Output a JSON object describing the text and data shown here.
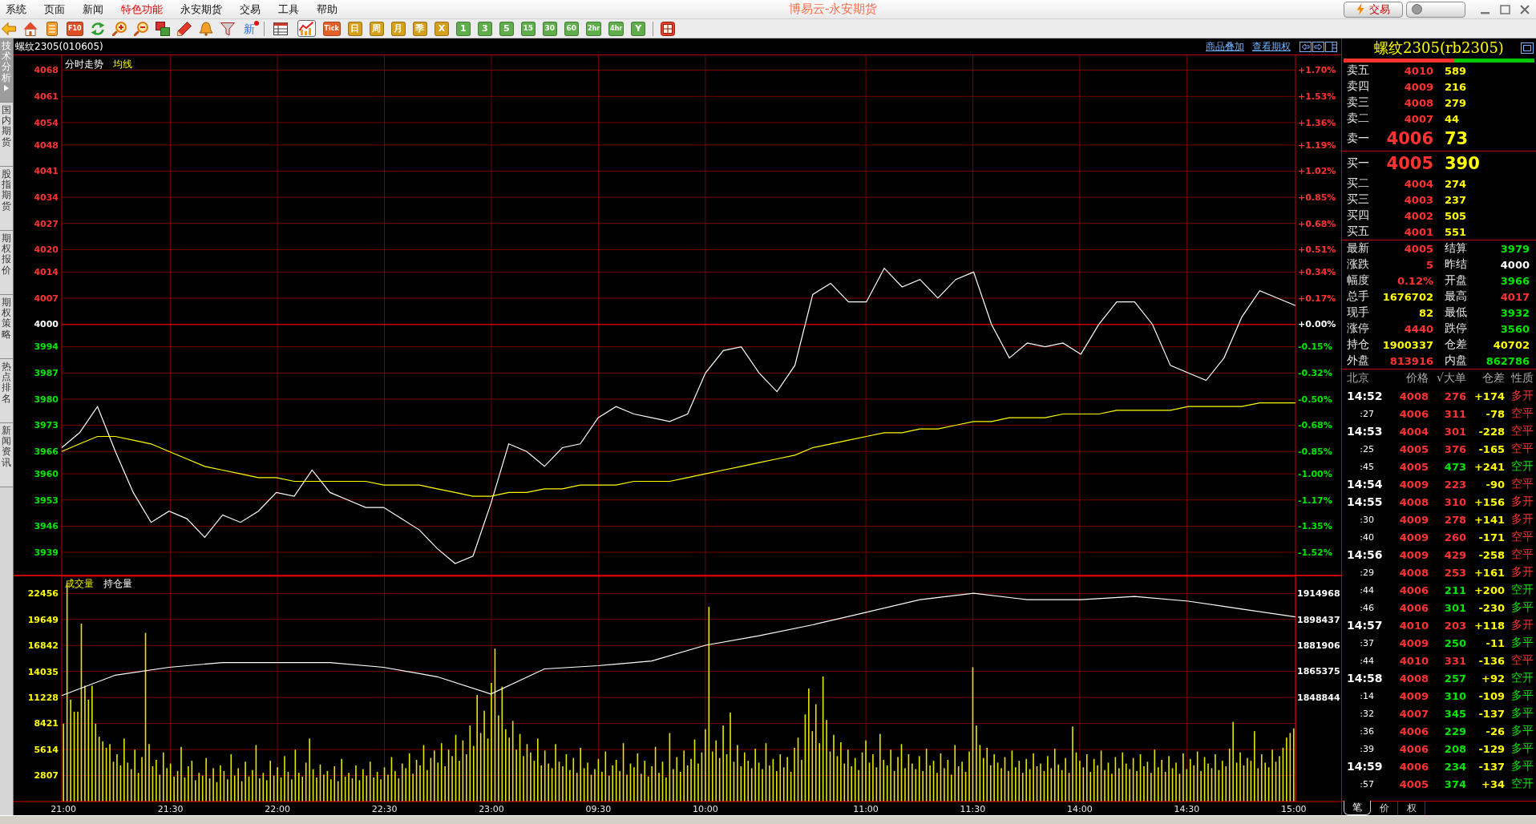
{
  "title_bar": {
    "menu": [
      {
        "label": "系统",
        "highlighted": false
      },
      {
        "label": "页面",
        "highlighted": false
      },
      {
        "label": "新闻",
        "highlighted": false
      },
      {
        "label": "特色功能",
        "highlighted": true
      },
      {
        "label": "永安期货",
        "highlighted": false
      },
      {
        "label": "交易",
        "highlighted": false
      },
      {
        "label": "工具",
        "highlighted": false
      },
      {
        "label": "帮助",
        "highlighted": false
      }
    ],
    "title": "博易云-永安期货",
    "trade_button": "交易"
  },
  "toolbar": {
    "actions": [
      {
        "kind": "arrow-left"
      },
      {
        "kind": "house"
      },
      {
        "kind": "notebook"
      },
      {
        "kind": "tile",
        "label": "F10"
      },
      {
        "kind": "refresh"
      },
      {
        "kind": "zoom-in"
      },
      {
        "kind": "zoom-out"
      },
      {
        "kind": "windows"
      },
      {
        "kind": "pencil"
      },
      {
        "kind": "bell"
      },
      {
        "kind": "funnel"
      },
      {
        "kind": "dot-text",
        "label": "新"
      }
    ],
    "views": [
      {
        "kind": "table",
        "selected": false
      },
      {
        "kind": "line-chart",
        "selected": true
      }
    ],
    "periods": [
      {
        "label": "Tick",
        "color": "#e4602a"
      },
      {
        "label": "日",
        "color": "#d6a01c"
      },
      {
        "label": "周",
        "color": "#d6a01c"
      },
      {
        "label": "月",
        "color": "#d6a01c"
      },
      {
        "label": "季",
        "color": "#d6a01c"
      },
      {
        "label": "X",
        "color": "#d6a01c"
      },
      {
        "label": "1",
        "color": "#5fae4b"
      },
      {
        "label": "3",
        "color": "#5fae4b"
      },
      {
        "label": "5",
        "color": "#5fae4b"
      },
      {
        "label": "15",
        "color": "#5fae4b"
      },
      {
        "label": "30",
        "color": "#5fae4b"
      },
      {
        "label": "60",
        "color": "#5fae4b"
      },
      {
        "label": "2hr",
        "color": "#5fae4b"
      },
      {
        "label": "4hr",
        "color": "#5fae4b"
      },
      {
        "label": "Y",
        "color": "#5fae4b"
      }
    ]
  },
  "sidebar": {
    "tabs": [
      {
        "label": "技术分析",
        "selected": true
      },
      {
        "label": "国内期货",
        "selected": false
      },
      {
        "label": "股指期货",
        "selected": false
      },
      {
        "label": "期权报价",
        "selected": false
      },
      {
        "label": "期权策略",
        "selected": false
      },
      {
        "label": "热点排名",
        "selected": false
      },
      {
        "label": "新闻资讯",
        "selected": false
      }
    ]
  },
  "chart_header": {
    "title": "螺纹2305(010605)",
    "links": [
      "商品叠加",
      "查看期权"
    ]
  },
  "price_chart": {
    "chart_data": {
      "type": "line",
      "categories": [
        null,
        null,
        null,
        null,
        null,
        null,
        null,
        null,
        null,
        null,
        null,
        null,
        null,
        null,
        null,
        null,
        null,
        null,
        null,
        null,
        null,
        null,
        null,
        null,
        null,
        null,
        null,
        null,
        null,
        null,
        null,
        null,
        null,
        null,
        null,
        null,
        null,
        null,
        null,
        null,
        null,
        null,
        null,
        null,
        null,
        null,
        null,
        null,
        null,
        null,
        null,
        null,
        null,
        null,
        null,
        null,
        null,
        null,
        null,
        null,
        null,
        null,
        null,
        null,
        null,
        null,
        null,
        null,
        null,
        null
      ],
      "ylim": [
        3933,
        4072
      ],
      "yticks": [
        4068,
        4061,
        4054,
        4048,
        4041,
        4034,
        4027,
        4020,
        4014,
        4007,
        4000,
        3994,
        3987,
        3980,
        3973,
        3966,
        3960,
        3953,
        3946,
        3939
      ],
      "grid": true,
      "ref_lines": [
        {
          "axis": "y",
          "value": 4000
        }
      ],
      "series": [
        {
          "name": "分时走势",
          "color": "#ffffff",
          "values": [
            3967,
            3971,
            3978,
            3966,
            3955,
            3947,
            3950,
            3948,
            3943,
            3949,
            3947,
            3950,
            3955,
            3954,
            3961,
            3955,
            3953,
            3951,
            3951,
            3948,
            3945,
            3940,
            3936,
            3938,
            3952,
            3968,
            3966,
            3962,
            3967,
            3968,
            3975,
            3978,
            3976,
            3975,
            3974,
            3976,
            3987,
            3993,
            3994,
            3987,
            3982,
            3989,
            4008,
            4011,
            4006,
            4006,
            4015,
            4010,
            4012,
            4007,
            4012,
            4014,
            4000,
            3991,
            3995,
            3994,
            3995,
            3992,
            4000,
            4006,
            4006,
            4000,
            3989,
            3987,
            3985,
            3991,
            4002,
            4009,
            4007,
            4005
          ]
        },
        {
          "name": "均线",
          "color": "#ffff00",
          "values": [
            3966,
            3968,
            3970,
            3970,
            3969,
            3968,
            3966,
            3964,
            3962,
            3961,
            3960,
            3959,
            3959,
            3958,
            3958,
            3958,
            3958,
            3958,
            3957,
            3957,
            3957,
            3956,
            3955,
            3954,
            3954,
            3955,
            3955,
            3956,
            3956,
            3957,
            3957,
            3957,
            3958,
            3958,
            3958,
            3959,
            3960,
            3961,
            3962,
            3963,
            3964,
            3965,
            3967,
            3968,
            3969,
            3970,
            3971,
            3971,
            3972,
            3972,
            3973,
            3974,
            3974,
            3975,
            3975,
            3975,
            3976,
            3976,
            3976,
            3977,
            3977,
            3977,
            3977,
            3978,
            3978,
            3978,
            3978,
            3979,
            3979,
            3979
          ]
        }
      ]
    },
    "percent_ticks": [
      "+1.70%",
      "+1.53%",
      "+1.36%",
      "+1.19%",
      "+1.02%",
      "+0.85%",
      "+0.68%",
      "+0.51%",
      "+0.34%",
      "+0.17%",
      "+0.00%",
      "-0.15%",
      "-0.32%",
      "-0.50%",
      "-0.68%",
      "-0.85%",
      "-1.00%",
      "-1.17%",
      "-1.35%",
      "-1.52%"
    ]
  },
  "volume_chart": {
    "chart_data": {
      "type": "bar",
      "categories": [
        "21:00",
        null,
        null,
        null,
        null,
        null,
        null,
        null,
        null,
        null,
        null,
        null,
        null,
        null,
        null,
        null,
        null,
        null,
        null,
        null,
        null,
        null,
        null,
        null,
        null,
        null,
        null,
        null,
        null,
        null,
        "21:30",
        null,
        null,
        null,
        null,
        null,
        null,
        null,
        null,
        null,
        null,
        null,
        null,
        null,
        null,
        null,
        null,
        null,
        null,
        null,
        null,
        null,
        null,
        null,
        null,
        null,
        null,
        null,
        null,
        null,
        "22:00",
        null,
        null,
        null,
        null,
        null,
        null,
        null,
        null,
        null,
        null,
        null,
        null,
        null,
        null,
        null,
        null,
        null,
        null,
        null,
        null,
        null,
        null,
        null,
        null,
        null,
        null,
        null,
        null,
        null,
        "22:30",
        null,
        null,
        null,
        null,
        null,
        null,
        null,
        null,
        null,
        null,
        null,
        null,
        null,
        null,
        null,
        null,
        null,
        null,
        null,
        null,
        null,
        null,
        null,
        null,
        null,
        null,
        null,
        null,
        null,
        "23:00",
        null,
        null,
        null,
        null,
        null,
        null,
        null,
        null,
        null,
        null,
        null,
        null,
        null,
        null,
        null,
        null,
        null,
        null,
        null,
        null,
        null,
        null,
        null,
        null,
        null,
        null,
        null,
        null,
        null,
        "09:30",
        null,
        null,
        null,
        null,
        null,
        null,
        null,
        null,
        null,
        null,
        null,
        null,
        null,
        null,
        null,
        null,
        null,
        null,
        null,
        null,
        null,
        null,
        null,
        null,
        null,
        null,
        null,
        null,
        null,
        "10:00",
        null,
        null,
        null,
        null,
        null,
        null,
        null,
        null,
        null,
        null,
        null,
        null,
        null,
        null,
        null,
        null,
        null,
        null,
        null,
        null,
        null,
        null,
        null,
        null,
        null,
        null,
        null,
        null,
        null,
        null,
        null,
        null,
        null,
        null,
        null,
        null,
        null,
        null,
        null,
        null,
        null,
        null,
        null,
        null,
        "11:00",
        null,
        null,
        null,
        null,
        null,
        null,
        null,
        null,
        null,
        null,
        null,
        null,
        null,
        null,
        null,
        null,
        null,
        null,
        null,
        null,
        null,
        null,
        null,
        null,
        null,
        null,
        null,
        null,
        null,
        "11:30",
        null,
        null,
        null,
        null,
        null,
        null,
        null,
        null,
        null,
        null,
        null,
        null,
        null,
        null,
        null,
        null,
        null,
        null,
        null,
        null,
        null,
        null,
        null,
        null,
        null,
        null,
        null,
        null,
        null,
        "14:00",
        null,
        null,
        null,
        null,
        null,
        null,
        null,
        null,
        null,
        null,
        null,
        null,
        null,
        null,
        null,
        null,
        null,
        null,
        null,
        null,
        null,
        null,
        null,
        null,
        null,
        null,
        null,
        null,
        null,
        "14:30",
        null,
        null,
        null,
        null,
        null,
        null,
        null,
        null,
        null,
        null,
        null,
        null,
        null,
        null,
        null,
        null,
        null,
        null,
        null,
        null,
        null,
        null,
        null,
        null,
        null,
        null,
        null,
        null,
        null,
        "15:00"
      ],
      "ylim": [
        0,
        24300
      ],
      "yticks": [
        22456,
        19649,
        16842,
        14035,
        11228,
        8421,
        5614,
        2807
      ],
      "grid": true,
      "series": [
        {
          "name": "成交量",
          "color": "#e6e600",
          "values": [
            8400,
            23500,
            11000,
            9700,
            9700,
            19200,
            12500,
            11000,
            12500,
            8400,
            7000,
            6500,
            5800,
            6200,
            4300,
            5100,
            3900,
            6800,
            4200,
            3500,
            5600,
            3100,
            4800,
            18200,
            6200,
            3800,
            4500,
            2900,
            5300,
            3600,
            4100,
            2700,
            3300,
            5900,
            2600,
            3800,
            4400,
            2300,
            3100,
            2800,
            4700,
            2500,
            3600,
            2100,
            3900,
            3300,
            2400,
            5100,
            2800,
            3600,
            2200,
            4300,
            2700,
            3400,
            6100,
            2500,
            3100,
            2300,
            4400,
            2800,
            3700,
            2600,
            4900,
            3200,
            2400,
            5600,
            3100,
            2700,
            4200,
            6800,
            3500,
            2600,
            4000,
            2900,
            3300,
            2400,
            3800,
            2200,
            4600,
            2700,
            3100,
            2500,
            3900,
            2300,
            3500,
            2800,
            4300,
            2600,
            3200,
            2400,
            3700,
            2900,
            4800,
            3300,
            2500,
            4100,
            3600,
            5200,
            3000,
            4500,
            3900,
            6100,
            3400,
            4700,
            5500,
            4200,
            6300,
            3800,
            5600,
            4900,
            7200,
            4400,
            6600,
            5100,
            8200,
            6000,
            11500,
            7400,
            9800,
            6800,
            12800,
            16500,
            9300,
            12400,
            7800,
            6900,
            8700,
            5600,
            7300,
            4900,
            6200,
            5300,
            4400,
            6800,
            3900,
            5500,
            4100,
            3600,
            6200,
            4300,
            3800,
            5100,
            3400,
            4700,
            3100,
            5800,
            3600,
            4200,
            2900,
            3500,
            4600,
            3200,
            5400,
            2800,
            3900,
            4500,
            3300,
            6300,
            2900,
            4100,
            3700,
            5200,
            3000,
            4400,
            2700,
            3800,
            5900,
            3100,
            4300,
            2600,
            7400,
            3500,
            4800,
            3200,
            5500,
            3900,
            4600,
            6700,
            4100,
            5300,
            7800,
            21000,
            5400,
            6600,
            4700,
            8200,
            5100,
            9600,
            4300,
            6100,
            3800,
            5300,
            4400,
            3600,
            5700,
            4200,
            3500,
            6300,
            3900,
            4600,
            3300,
            5100,
            3700,
            4800,
            3200,
            5800,
            6900,
            4500,
            9400,
            12200,
            7600,
            10500,
            6300,
            13500,
            8800,
            5400,
            7200,
            4900,
            6400,
            4100,
            5600,
            3800,
            4700,
            3400,
            5300,
            6600,
            4200,
            5100,
            3700,
            7300,
            4500,
            3900,
            5600,
            3300,
            4800,
            6200,
            3600,
            5100,
            4100,
            3500,
            4900,
            3300,
            5700,
            3900,
            4400,
            3100,
            5200,
            3600,
            4500,
            2900,
            6100,
            3800,
            4300,
            3200,
            5400,
            14500,
            8200,
            6100,
            4700,
            5800,
            3900,
            5100,
            4200,
            3600,
            4800,
            3300,
            5500,
            3700,
            4400,
            3100,
            4600,
            3500,
            5200,
            3800,
            4100,
            3300,
            4900,
            3600,
            5700,
            4000,
            3400,
            4700,
            3100,
            8100,
            5300,
            4400,
            3700,
            5100,
            3200,
            4600,
            3900,
            5500,
            3400,
            4200,
            3000,
            4800,
            3600,
            5300,
            4100,
            3500,
            4700,
            3300,
            5100,
            3800,
            4300,
            3100,
            5600,
            3700,
            4500,
            3200,
            4900,
            3600,
            4200,
            3000,
            5200,
            3500,
            4600,
            3900,
            5400,
            3300,
            4800,
            4100,
            3600,
            5100,
            3400,
            4400,
            3800,
            5700,
            8600,
            4200,
            5300,
            3900,
            4700,
            4400,
            7600,
            3600,
            5100,
            4200,
            3700,
            5600,
            4300,
            4900,
            5800,
            6900,
            7400,
            7900
          ]
        }
      ]
    }
  },
  "open_interest_chart": {
    "chart_data": {
      "type": "line",
      "categories": [
        null,
        null,
        null,
        null,
        null,
        null,
        null,
        null,
        null,
        null,
        null,
        null,
        null,
        null,
        null,
        null,
        null,
        null,
        null,
        null,
        null,
        null,
        null,
        null
      ],
      "ylim": [
        1782700,
        1925800
      ],
      "yticks": [
        1914968,
        1898437,
        1881906,
        1865375,
        1848844
      ],
      "series": [
        {
          "name": "持仓量",
          "color": "#ffffff",
          "values": [
            1850000,
            1863000,
            1868000,
            1871000,
            1871000,
            1871000,
            1868000,
            1862000,
            1851000,
            1867000,
            1869000,
            1872000,
            1882000,
            1888000,
            1895000,
            1903000,
            1911000,
            1915000,
            1911000,
            1911000,
            1913000,
            1910000,
            1905000,
            1900000
          ]
        }
      ]
    }
  },
  "quote_panel": {
    "title": "螺纹2305(rb2305)",
    "ratio_bar": {
      "level": 0.58
    },
    "asks": [
      {
        "label": "卖五",
        "price": "4010",
        "volume": "589",
        "kind": "level"
      },
      {
        "label": "卖四",
        "price": "4009",
        "volume": "216",
        "kind": "level"
      },
      {
        "label": "卖三",
        "price": "4008",
        "volume": "279",
        "kind": "level"
      },
      {
        "label": "卖二",
        "price": "4007",
        "volume": "44",
        "kind": "level"
      },
      {
        "label": "卖一",
        "price": "4006",
        "volume": "73",
        "kind": "best"
      }
    ],
    "bids": [
      {
        "label": "买一",
        "price": "4005",
        "volume": "390",
        "kind": "best"
      },
      {
        "label": "买二",
        "price": "4004",
        "volume": "274",
        "kind": "level"
      },
      {
        "label": "买三",
        "price": "4003",
        "volume": "237",
        "kind": "level"
      },
      {
        "label": "买四",
        "price": "4002",
        "volume": "505",
        "kind": "level"
      },
      {
        "label": "买五",
        "price": "4001",
        "volume": "551",
        "kind": "level"
      }
    ],
    "stats": [
      {
        "label": "最新",
        "value": "4005",
        "color": "#ff3232"
      },
      {
        "label": "结算",
        "value": "3979",
        "color": "#00e600"
      },
      {
        "label": "涨跌",
        "value": "5",
        "color": "#ff3232"
      },
      {
        "label": "昨结",
        "value": "4000",
        "color": "#ffffff"
      },
      {
        "label": "幅度",
        "value": "0.12%",
        "color": "#ff3232"
      },
      {
        "label": "开盘",
        "value": "3966",
        "color": "#00e600"
      },
      {
        "label": "总手",
        "value": "1676702",
        "color": "#ffff00"
      },
      {
        "label": "最高",
        "value": "4017",
        "color": "#ff3232"
      },
      {
        "label": "现手",
        "value": "82",
        "color": "#ffff00"
      },
      {
        "label": "最低",
        "value": "3932",
        "color": "#00e600"
      },
      {
        "label": "涨停",
        "value": "4440",
        "color": "#ff3232"
      },
      {
        "label": "跌停",
        "value": "3560",
        "color": "#00e600"
      },
      {
        "label": "持仓",
        "value": "1900337",
        "color": "#ffff00"
      },
      {
        "label": "仓差",
        "value": "40702",
        "color": "#ffff00"
      },
      {
        "label": "外盘",
        "value": "813916",
        "color": "#ff3232"
      },
      {
        "label": "内盘",
        "value": "862786",
        "color": "#00e600"
      }
    ],
    "trades": {
      "columns": [
        "北京",
        "价格",
        "√大单",
        "仓差",
        "性质"
      ],
      "rows": [
        {
          "time": "14:52",
          "kind": "minute",
          "price": "4008",
          "volume": "276",
          "change": "+174",
          "nature": "多开",
          "color": "#ff3232"
        },
        {
          "time": ":27",
          "kind": "second",
          "price": "4006",
          "volume": "311",
          "change": "-78",
          "nature": "空平",
          "color": "#ff3232"
        },
        {
          "time": "14:53",
          "kind": "minute",
          "price": "4004",
          "volume": "301",
          "change": "-228",
          "nature": "空平",
          "color": "#ff3232"
        },
        {
          "time": ":25",
          "kind": "second",
          "price": "4005",
          "volume": "376",
          "change": "-165",
          "nature": "空平",
          "color": "#ff3232"
        },
        {
          "time": ":45",
          "kind": "second",
          "price": "4005",
          "volume": "473",
          "change": "+241",
          "nature": "空开",
          "color": "#00e600"
        },
        {
          "time": "14:54",
          "kind": "minute",
          "price": "4009",
          "volume": "223",
          "change": "-90",
          "nature": "空平",
          "color": "#ff3232"
        },
        {
          "time": "14:55",
          "kind": "minute",
          "price": "4008",
          "volume": "310",
          "change": "+156",
          "nature": "多开",
          "color": "#ff3232"
        },
        {
          "time": ":30",
          "kind": "second",
          "price": "4009",
          "volume": "278",
          "change": "+141",
          "nature": "多开",
          "color": "#ff3232"
        },
        {
          "time": ":40",
          "kind": "second",
          "price": "4009",
          "volume": "260",
          "change": "-171",
          "nature": "空平",
          "color": "#ff3232"
        },
        {
          "time": "14:56",
          "kind": "minute",
          "price": "4009",
          "volume": "429",
          "change": "-258",
          "nature": "空平",
          "color": "#ff3232"
        },
        {
          "time": ":29",
          "kind": "second",
          "price": "4008",
          "volume": "253",
          "change": "+161",
          "nature": "多开",
          "color": "#ff3232"
        },
        {
          "time": ":44",
          "kind": "second",
          "price": "4006",
          "volume": "211",
          "change": "+200",
          "nature": "空开",
          "color": "#00e600"
        },
        {
          "time": ":46",
          "kind": "second",
          "price": "4006",
          "volume": "301",
          "change": "-230",
          "nature": "多平",
          "color": "#00e600"
        },
        {
          "time": "14:57",
          "kind": "minute",
          "price": "4010",
          "volume": "203",
          "change": "+118",
          "nature": "多开",
          "color": "#ff3232"
        },
        {
          "time": ":37",
          "kind": "second",
          "price": "4009",
          "volume": "250",
          "change": "-11",
          "nature": "多平",
          "color": "#00e600"
        },
        {
          "time": ":44",
          "kind": "second",
          "price": "4010",
          "volume": "331",
          "change": "-136",
          "nature": "空平",
          "color": "#ff3232"
        },
        {
          "time": "14:58",
          "kind": "minute",
          "price": "4008",
          "volume": "257",
          "change": "+92",
          "nature": "空开",
          "color": "#00e600"
        },
        {
          "time": ":14",
          "kind": "second",
          "price": "4009",
          "volume": "310",
          "change": "-109",
          "nature": "多平",
          "color": "#00e600"
        },
        {
          "time": ":32",
          "kind": "second",
          "price": "4007",
          "volume": "345",
          "change": "-137",
          "nature": "多平",
          "color": "#00e600"
        },
        {
          "time": ":36",
          "kind": "second",
          "price": "4006",
          "volume": "229",
          "change": "-26",
          "nature": "多平",
          "color": "#00e600"
        },
        {
          "time": ":39",
          "kind": "second",
          "price": "4006",
          "volume": "208",
          "change": "-129",
          "nature": "多平",
          "color": "#00e600"
        },
        {
          "time": "14:59",
          "kind": "minute",
          "price": "4006",
          "volume": "234",
          "change": "-137",
          "nature": "多平",
          "color": "#00e600"
        },
        {
          "time": ":57",
          "kind": "second",
          "price": "4005",
          "volume": "374",
          "change": "+34",
          "nature": "空开",
          "color": "#00e600"
        }
      ]
    },
    "tabs": [
      {
        "label": "笔",
        "selected": true
      },
      {
        "label": "价",
        "selected": false
      },
      {
        "label": "权",
        "selected": false
      }
    ]
  }
}
